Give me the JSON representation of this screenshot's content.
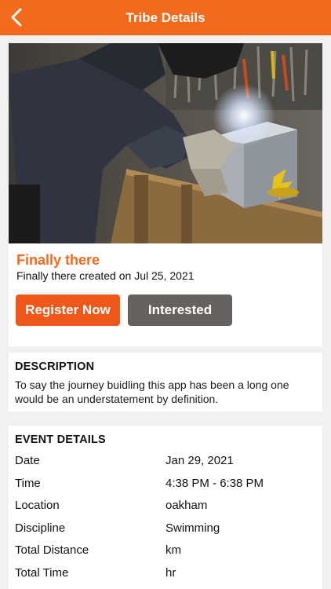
{
  "header": {
    "title": "Tribe Details",
    "back_icon": "chevron-left-icon",
    "background": "#f36a1d"
  },
  "event": {
    "title": "Finally there",
    "subtitle": "Finally there created on Jul 25, 2021",
    "image": "photo of a person in a suit welding a metal box at a workbench",
    "register_label": "Register Now",
    "interested_label": "Interested",
    "accent": "#f36a1d"
  },
  "description": {
    "heading": "DESCRIPTION",
    "text": "To say the journey buidling this app has been a long one would be an understatement by definition."
  },
  "event_details": {
    "heading": "EVENT DETAILS",
    "rows": [
      {
        "label": "Date",
        "value": "Jan 29, 2021"
      },
      {
        "label": "Time",
        "value": "4:38 PM - 6:38 PM"
      },
      {
        "label": "Location",
        "value": "oakham"
      },
      {
        "label": "Discipline",
        "value": "Swimming"
      },
      {
        "label": "Total Distance",
        "value": "km"
      },
      {
        "label": "Total Time",
        "value": "hr"
      }
    ]
  }
}
